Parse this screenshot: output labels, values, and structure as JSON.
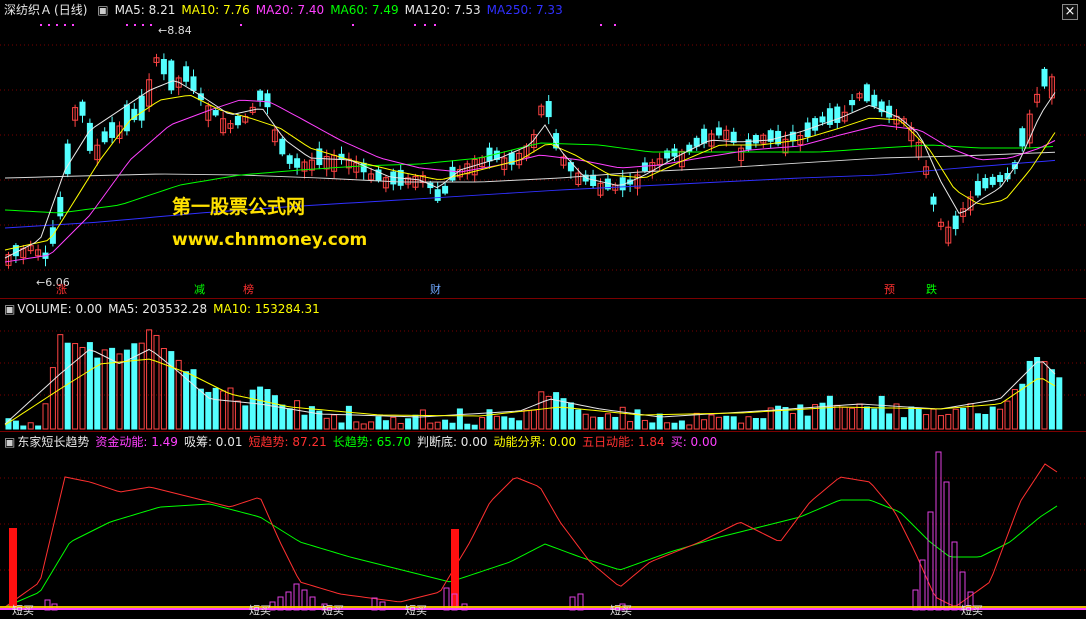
{
  "main": {
    "stock_name": "深纺织Ａ",
    "period": "(日线)",
    "ma_items": [
      {
        "label": "MA5: 8.21",
        "color": "#e8e8e8"
      },
      {
        "label": "MA10: 7.76",
        "color": "#ffff00"
      },
      {
        "label": "MA20: 7.40",
        "color": "#ff40ff"
      },
      {
        "label": "MA60: 7.49",
        "color": "#00ff00"
      },
      {
        "label": "MA120: 7.53",
        "color": "#e8e8e8"
      },
      {
        "label": "MA250: 7.33",
        "color": "#3030ff"
      }
    ],
    "high_price_label": "8.84",
    "low_price_label": "6.06",
    "watermark_title": "第一股票公式网",
    "watermark_url": "www.chnmoney.com",
    "events": [
      {
        "label": "涨",
        "color": "#ff3030"
      },
      {
        "label": "减",
        "color": "#00ff00"
      },
      {
        "label": "榜",
        "color": "#ff3030"
      },
      {
        "label": "财",
        "color": "#6fa8ff"
      },
      {
        "label": "预",
        "color": "#ff3030"
      },
      {
        "label": "跌",
        "color": "#00ff00"
      }
    ],
    "close_glyph": "×"
  },
  "volume": {
    "title": "VOLUME: 0.00",
    "ma5": "MA5: 203532.28",
    "ma10": "MA10: 153284.31"
  },
  "indicator": {
    "name": "东家短长趋势",
    "items": [
      {
        "label": "资金动能: 1.49",
        "color": "#ff40ff"
      },
      {
        "label": "吸筹: 0.01",
        "color": "#e8e8e8"
      },
      {
        "label": "短趋势: 87.21",
        "color": "#ff3030"
      },
      {
        "label": "长趋势: 65.70",
        "color": "#00ff00"
      },
      {
        "label": "判断底: 0.00",
        "color": "#e8e8e8"
      },
      {
        "label": "动能分界: 0.00",
        "color": "#ffff00"
      },
      {
        "label": "五日动能: 1.84",
        "color": "#ff3030"
      },
      {
        "label": "买: 0.00",
        "color": "#ff40ff"
      }
    ],
    "signal_label": "短买"
  },
  "colors": {
    "up": "#ff4444",
    "down": "#54ffff",
    "grid": "#7a0000"
  }
}
